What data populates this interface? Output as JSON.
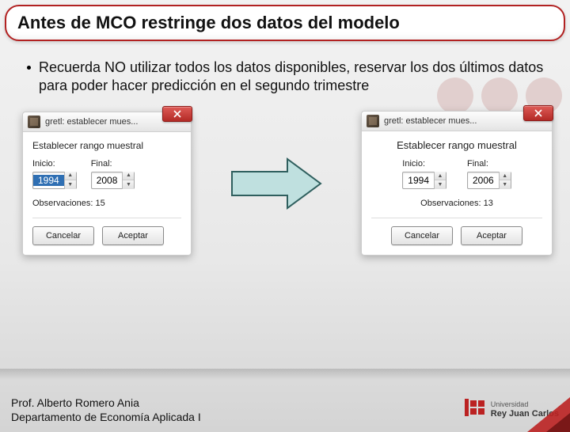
{
  "title": "Antes de MCO restringe dos datos del modelo",
  "bullet": "Recuerda NO utilizar todos los datos disponibles, reservar los dos últimos datos para poder hacer predicción en el segundo trimestre",
  "dialogA": {
    "windowTitle": "gretl: establecer mues...",
    "heading": "Establecer rango muestral",
    "startLabel": "Inicio:",
    "endLabel": "Final:",
    "startValue": "1994",
    "endValue": "2008",
    "obs": "Observaciones: 15",
    "cancel": "Cancelar",
    "accept": "Aceptar"
  },
  "dialogB": {
    "windowTitle": "gretl: establecer mues...",
    "heading": "Establecer rango muestral",
    "startLabel": "Inicio:",
    "endLabel": "Final:",
    "startValue": "1994",
    "endValue": "2006",
    "obs": "Observaciones: 13",
    "cancel": "Cancelar",
    "accept": "Aceptar"
  },
  "footer": {
    "line1": "Prof. Alberto Romero Ania",
    "line2": "Departamento de Economía Aplicada I",
    "uniTop": "Universidad",
    "uniBottom": "Rey Juan Carlos"
  }
}
